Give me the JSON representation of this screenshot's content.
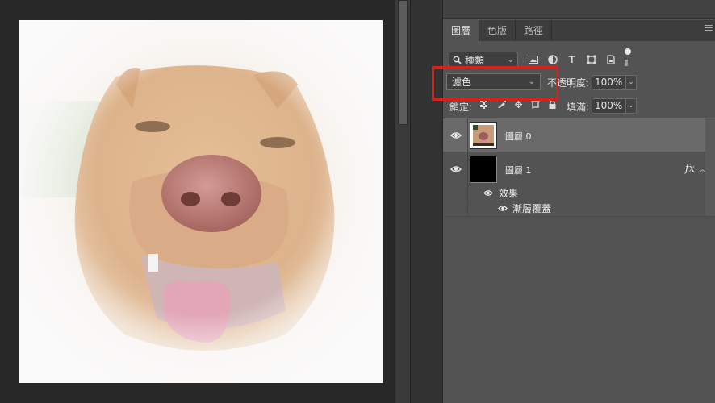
{
  "panel": {
    "tabs": [
      {
        "label": "圖層",
        "active": true
      },
      {
        "label": "色版",
        "active": false
      },
      {
        "label": "路徑",
        "active": false
      }
    ]
  },
  "filter": {
    "kind_label": "種類",
    "icons": [
      "image-filter-icon",
      "adjustment-filter-icon",
      "type-filter-icon",
      "shape-filter-icon",
      "smart-object-filter-icon",
      "filter-toggle-icon"
    ]
  },
  "blend": {
    "mode": "濾色",
    "opacity_label": "不透明度:",
    "opacity_value": "100%",
    "lock_label": "鎖定:",
    "fill_label": "填滿:",
    "fill_value": "100%"
  },
  "layers": [
    {
      "name": "圖層 0",
      "visible": true,
      "selected": true
    },
    {
      "name": "圖層 1",
      "visible": true,
      "selected": false,
      "fx": "fx",
      "effects_label": "效果",
      "effect_items": [
        "漸層覆蓋"
      ]
    }
  ],
  "colors": {
    "highlight": "#d9211c",
    "panel_bg": "#535353",
    "selected_row": "#6a6a6a"
  }
}
